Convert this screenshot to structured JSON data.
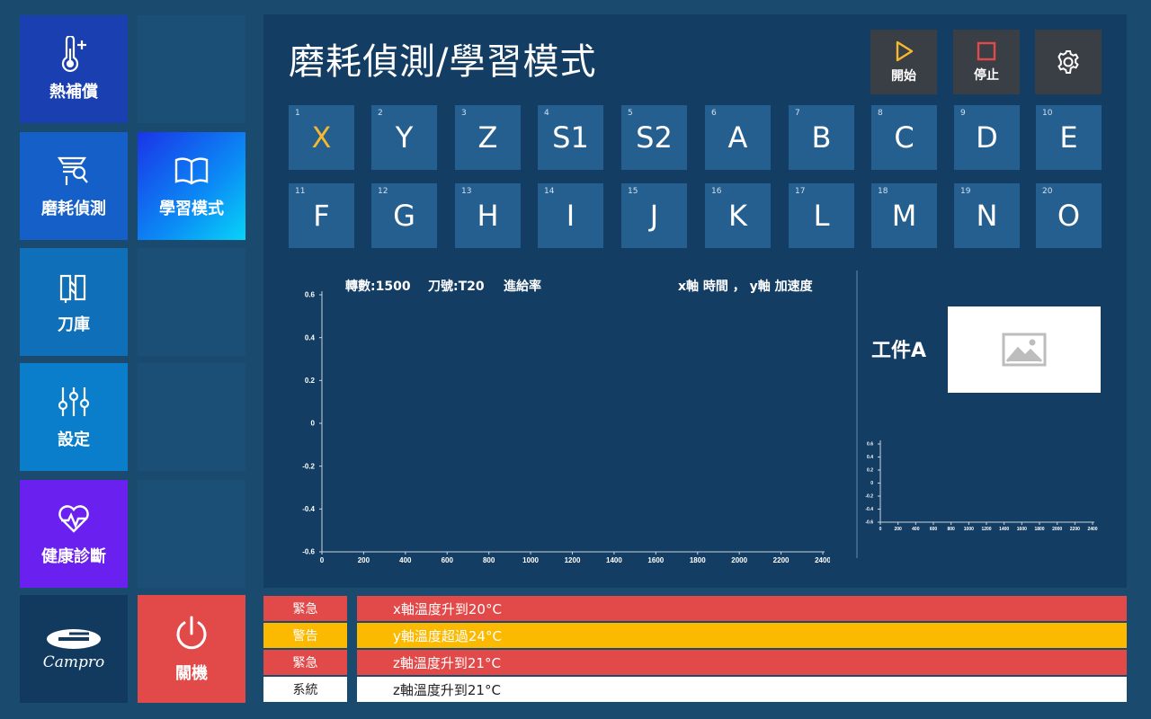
{
  "nav": {
    "thermal": "熱補償",
    "wear": "磨耗偵測",
    "learn": "學習模式",
    "magazine": "刀庫",
    "settings": "設定",
    "health": "健康診斷",
    "power": "關機"
  },
  "logo_text": "Campro",
  "page": {
    "title": "磨耗偵測/學習模式",
    "start_label": "開始",
    "stop_label": "停止"
  },
  "axes": [
    {
      "num": "1",
      "label": "X"
    },
    {
      "num": "2",
      "label": "Y"
    },
    {
      "num": "3",
      "label": "Z"
    },
    {
      "num": "4",
      "label": "S1"
    },
    {
      "num": "5",
      "label": "S2"
    },
    {
      "num": "6",
      "label": "A"
    },
    {
      "num": "7",
      "label": "B"
    },
    {
      "num": "8",
      "label": "C"
    },
    {
      "num": "9",
      "label": "D"
    },
    {
      "num": "10",
      "label": "E"
    },
    {
      "num": "11",
      "label": "F"
    },
    {
      "num": "12",
      "label": "G"
    },
    {
      "num": "13",
      "label": "H"
    },
    {
      "num": "14",
      "label": "I"
    },
    {
      "num": "15",
      "label": "J"
    },
    {
      "num": "16",
      "label": "K"
    },
    {
      "num": "17",
      "label": "L"
    },
    {
      "num": "18",
      "label": "M"
    },
    {
      "num": "19",
      "label": "N"
    },
    {
      "num": "20",
      "label": "O"
    }
  ],
  "chart_info": {
    "speed": "轉數:1500",
    "tool": "刀號:T20",
    "feed": "進給率",
    "axes_desc": "x軸 時間 ， y軸 加速度"
  },
  "workpiece": {
    "label": "工件A"
  },
  "chart_data": [
    {
      "type": "line",
      "yticks": [
        "0.6",
        "0.4",
        "0.2",
        "0",
        "-0.2",
        "-0.4",
        "-0.6"
      ],
      "xticks": [
        "0",
        "200",
        "400",
        "600",
        "800",
        "1000",
        "1200",
        "1400",
        "1600",
        "1800",
        "2000",
        "2200",
        "2400"
      ],
      "ylim": [
        -0.6,
        0.6
      ],
      "xlim": [
        0,
        2400
      ],
      "series": []
    },
    {
      "type": "line",
      "yticks": [
        "0.6",
        "0.4",
        "0.2",
        "0",
        "-0.2",
        "-0.4",
        "-0.6"
      ],
      "xticks": [
        "0",
        "200",
        "400",
        "600",
        "800",
        "1000",
        "1200",
        "1400",
        "1600",
        "1800",
        "2000",
        "2200",
        "2400"
      ],
      "ylim": [
        -0.6,
        0.6
      ],
      "xlim": [
        0,
        2400
      ],
      "series": []
    }
  ],
  "alerts": [
    {
      "level": "緊急",
      "message": "x軸溫度升到20°C",
      "color": "#e24a4a",
      "text_color": "#ffffff"
    },
    {
      "level": "警告",
      "message": "y軸溫度超過24°C",
      "color": "#fbb900",
      "text_color": "#ffffff"
    },
    {
      "level": "緊急",
      "message": "z軸溫度升到21°C",
      "color": "#e24a4a",
      "text_color": "#ffffff"
    },
    {
      "level": "系統",
      "message": "z軸溫度升到21°C",
      "color": "#ffffff",
      "text_color": "#222222"
    }
  ]
}
